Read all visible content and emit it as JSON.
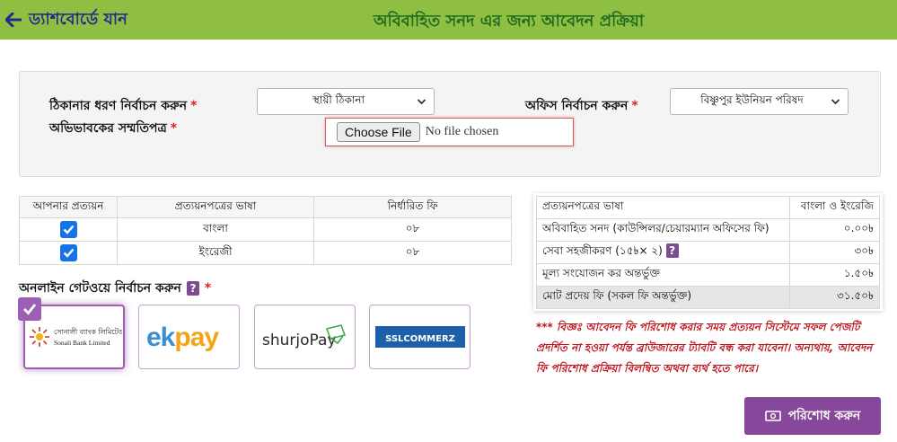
{
  "header": {
    "back_label": "ড্যাশবোর্ডে যান",
    "title": "অবিবাহিত সনদ এর জন্য আবেদন প্রক্রিয়া"
  },
  "form": {
    "address_type_label": "ঠিকানার ধরণ নির্বাচন করুন",
    "address_type_value": "স্থায়ী ঠিকানা",
    "office_label": "অফিস নির্বাচন করুন",
    "office_value": "বিষ্ণুপুর ইউনিয়ন পরিষদ",
    "guardian_consent_label": "অভিভাবকের সম্মতিপত্র",
    "required_mark": "*",
    "file_button": "Choose File",
    "file_status": "No file chosen"
  },
  "fee_table": {
    "headers": [
      "আপনার প্রত্যয়ন",
      "প্রত্যয়নপত্রের ভাষা",
      "নির্ধারিত ফি"
    ],
    "rows": [
      {
        "checked": true,
        "language": "বাংলা",
        "fee": "০৮"
      },
      {
        "checked": true,
        "language": "ইংরেজী",
        "fee": "০৮"
      }
    ]
  },
  "gateway": {
    "label": "অনলাইন গেটওয়ে নির্বাচন করুন",
    "help": "?",
    "options": [
      {
        "name": "Sonali Bank Limited",
        "name_bn": "সোনালী ব্যাংক লিমিটেড",
        "selected": true
      },
      {
        "name": "ekpay",
        "selected": false
      },
      {
        "name": "shurjoPay",
        "selected": false
      },
      {
        "name": "SSLCOMMERZ",
        "selected": false
      }
    ]
  },
  "summary": {
    "rows": [
      {
        "label": "প্রত্যয়নপত্রের ভাষা",
        "value": "বাংলা ও ইংরেজি"
      },
      {
        "label": "অবিবাহিত সনদ (কাউন্সিলর/চেয়ারম্যান অফিসের ফি)",
        "value": "০.০০৳"
      },
      {
        "label": "সেবা সহজীকরণ (১৫৳× ২)",
        "value": "৩০৳",
        "help": "?"
      },
      {
        "label": "মূল্য সংযোজন কর অন্তর্ভুক্ত",
        "value": "১.৫০৳"
      },
      {
        "label": "মোট প্রদেয় ফি (সকল ফি অন্তর্ভুক্ত)",
        "value": "৩১.৫০৳"
      }
    ]
  },
  "notice": "*** বিজ্ঞঃ আবেদন ফি পরিশোধ করার সময় প্রত্যয়ন সিস্টেমে সফল পেজটি প্রদর্শিত না হওয়া পর্যন্ত ব্রাউজারের ট্যাবটি বন্ধ করা যাবেনা। অন্যথায়, আবেদন ফি পরিশোধ প্রক্রিয়া বিলম্বিত অথবা ব্যর্থ হতে পারে।",
  "pay_button": "পরিশোধ করুন",
  "colors": {
    "header_bg": "#8fbf42",
    "title": "#1f6b1f",
    "back": "#1e2f8a",
    "accent": "#87489c",
    "notice": "#c0141e",
    "checkbox": "#1473e6"
  }
}
